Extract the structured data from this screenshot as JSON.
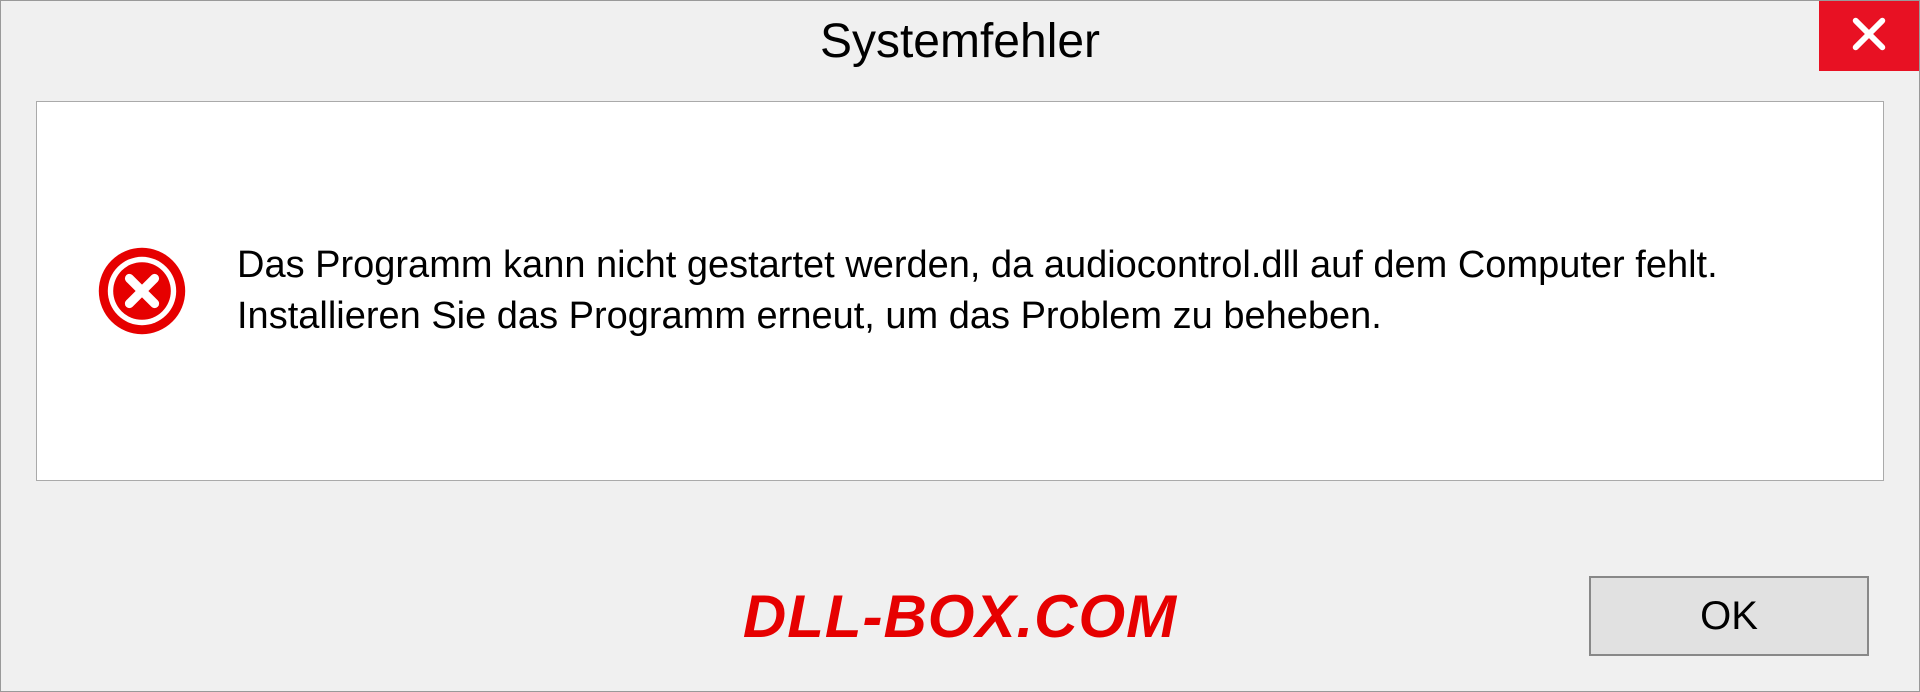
{
  "dialog": {
    "title": "Systemfehler",
    "message": "Das Programm kann nicht gestartet werden, da audiocontrol.dll auf dem Computer fehlt. Installieren Sie das Programm erneut, um das Problem zu beheben.",
    "ok_label": "OK"
  },
  "watermark": "DLL-BOX.COM"
}
